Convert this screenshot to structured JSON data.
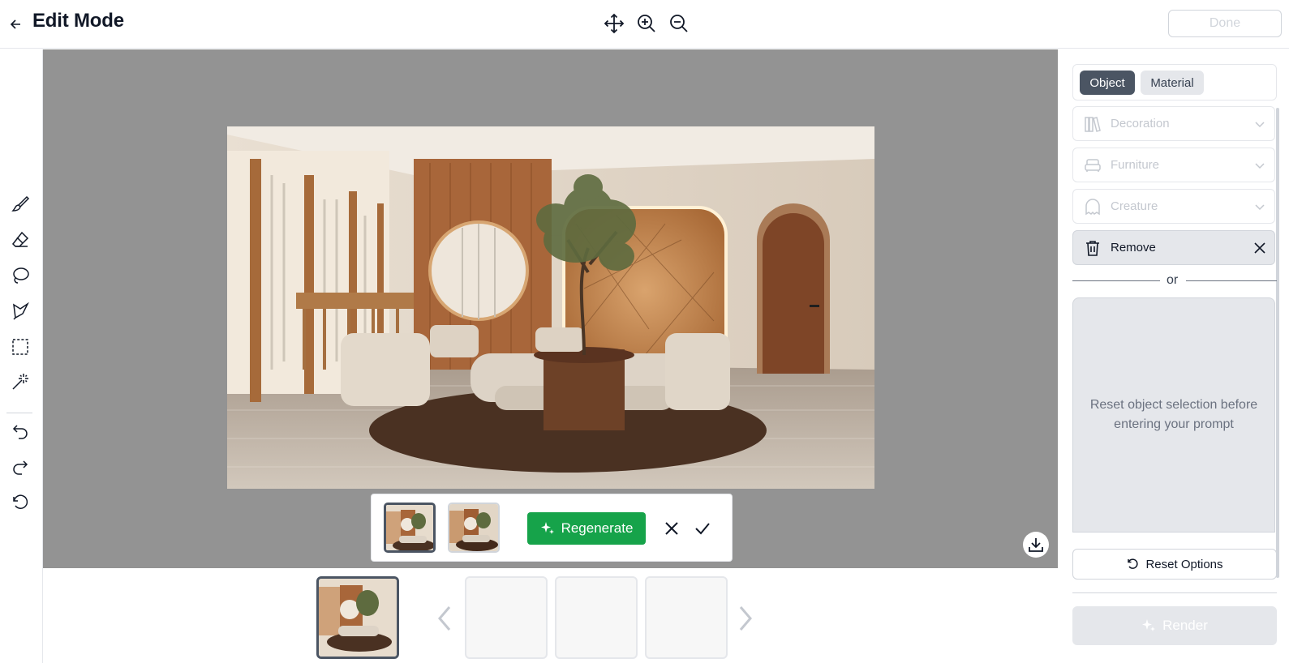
{
  "header": {
    "title": "Edit Mode",
    "done_label": "Done",
    "tools": [
      "move-icon",
      "zoom-in-icon",
      "zoom-out-icon"
    ]
  },
  "toolbar": {
    "tools": [
      "brush-icon",
      "eraser-icon",
      "lasso-icon",
      "polygon-lasso-icon",
      "rect-select-icon",
      "magic-wand-icon",
      "undo-icon",
      "redo-icon",
      "reset-icon"
    ]
  },
  "variants": {
    "regenerate_label": "Regenerate"
  },
  "panel": {
    "tabs": [
      {
        "label": "Object",
        "active": true
      },
      {
        "label": "Material",
        "active": false
      }
    ],
    "options": [
      {
        "label": "Decoration",
        "icon": "books-icon"
      },
      {
        "label": "Furniture",
        "icon": "sofa-icon"
      },
      {
        "label": "Creature",
        "icon": "ghost-icon"
      },
      {
        "label": "Remove",
        "icon": "trash-icon"
      }
    ],
    "or_label": "or",
    "prompt_hint": "Reset object selection before entering your prompt",
    "reset_label": "Reset Options",
    "render_label": "Render"
  },
  "colors": {
    "accent_green": "#16a34a",
    "active_tab": "#4b5563",
    "canvas_bg": "#939393"
  }
}
